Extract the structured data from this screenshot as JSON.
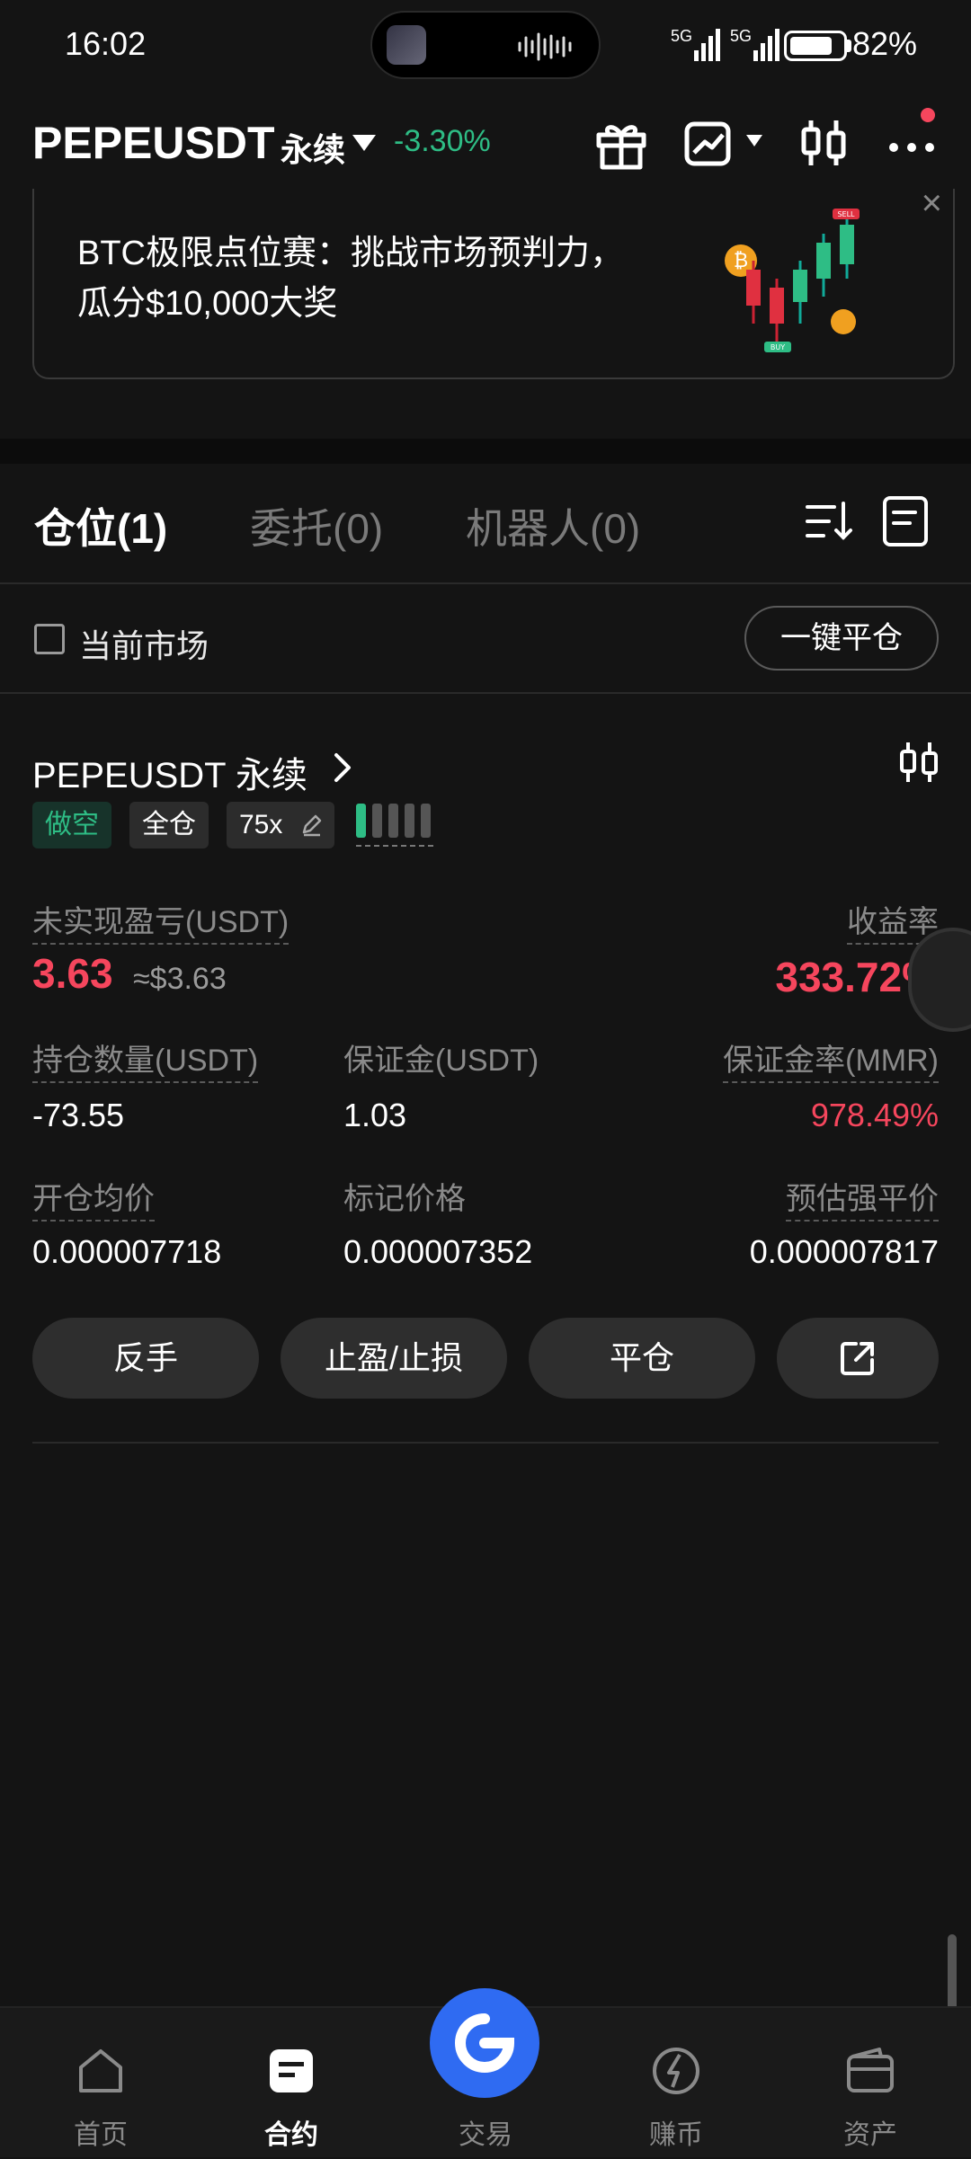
{
  "status_bar": {
    "time": "16:02",
    "signal1": "5G",
    "signal2": "5G",
    "battery_percent": "82%",
    "battery_level": 0.82
  },
  "header": {
    "symbol": "PEPEUSDT",
    "contract_type": "永续",
    "change": "-3.30%",
    "icons": [
      "gift-icon",
      "chart-trend-icon",
      "candlestick-icon",
      "more-icon"
    ]
  },
  "banner": {
    "text": "BTC极限点位赛：挑战市场预判力，瓜分$10,000大奖",
    "art_sell": "SELL",
    "art_buy": "BUY"
  },
  "tabs": [
    {
      "label": "仓位(1)",
      "active": true
    },
    {
      "label": "委托(0)",
      "active": false
    },
    {
      "label": "机器人(0)",
      "active": false
    }
  ],
  "filter": {
    "label": "当前市场",
    "close_all": "一键平仓"
  },
  "position": {
    "title": "PEPEUSDT 永续",
    "side": "做空",
    "margin_mode": "全仓",
    "leverage": "75x",
    "risk_level": 1,
    "unrealized_pnl_label": "未实现盈亏(USDT)",
    "unrealized_pnl": "3.63",
    "unrealized_pnl_usd": "≈$3.63",
    "roe_label": "收益率",
    "roe": "333.72%",
    "size_label": "持仓数量(USDT)",
    "size": "-73.55",
    "margin_label": "保证金(USDT)",
    "margin": "1.03",
    "mmr_label": "保证金率(MMR)",
    "mmr": "978.49%",
    "entry_label": "开仓均价",
    "entry": "0.000007718",
    "mark_label": "标记价格",
    "mark": "0.000007352",
    "liq_label": "预估强平价",
    "liq": "0.000007817",
    "actions": {
      "reverse": "反手",
      "tpsl": "止盈/止损",
      "close": "平仓"
    }
  },
  "bottom_nav": [
    {
      "label": "首页",
      "icon": "home-icon",
      "active": false
    },
    {
      "label": "合约",
      "icon": "futures-icon",
      "active": true
    },
    {
      "label": "交易",
      "icon": "trade-icon",
      "active": false
    },
    {
      "label": "赚币",
      "icon": "earn-icon",
      "active": false
    },
    {
      "label": "资产",
      "icon": "wallet-icon",
      "active": false
    }
  ],
  "colors": {
    "background": "#141414",
    "green": "#2ebd85",
    "red": "#f6465d",
    "accent_blue": "#2f6bf2"
  }
}
